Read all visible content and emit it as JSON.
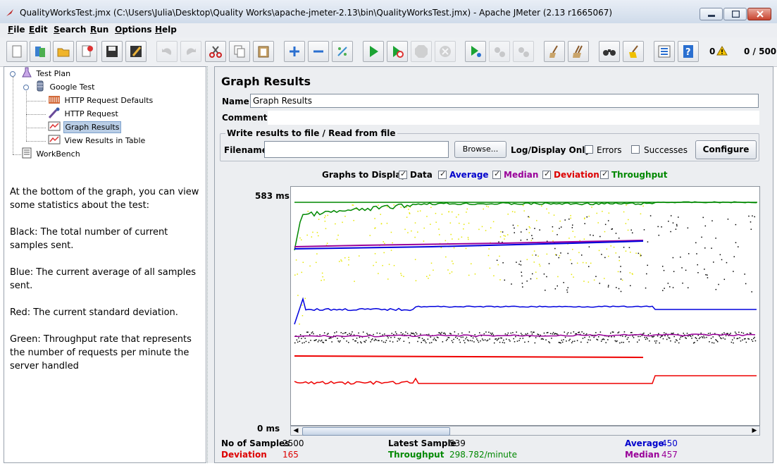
{
  "window": {
    "title": "QualityWorksTest.jmx (C:\\Users\\Julia\\Desktop\\Quality Works\\apache-jmeter-2.13\\bin\\QualityWorksTest.jmx) - Apache JMeter (2.13 r1665067)"
  },
  "menu": [
    {
      "label": "File",
      "key": "F",
      "rest": "ile"
    },
    {
      "label": "Edit",
      "key": "E",
      "rest": "dit"
    },
    {
      "label": "Search",
      "key": "S",
      "rest": "earch"
    },
    {
      "label": "Run",
      "key": "R",
      "rest": "un"
    },
    {
      "label": "Options",
      "key": "O",
      "rest": "ptions"
    },
    {
      "label": "Help",
      "key": "H",
      "rest": "elp"
    }
  ],
  "toolbar": {
    "buttons": [
      "new-icon",
      "templates-icon",
      "open-icon",
      "close-icon",
      "save-icon",
      "save-as-icon",
      "undo-icon",
      "redo-icon",
      "cut-icon",
      "copy-icon",
      "paste-icon",
      "expand-icon",
      "collapse-icon",
      "toggle-icon",
      "start-icon",
      "start-no-pauses-icon",
      "stop-icon",
      "shutdown-icon",
      "remote-start-icon",
      "remote-stop-icon",
      "remote-exit-icon",
      "clear-icon",
      "clear-all-icon",
      "search-icon",
      "reset-search-icon",
      "function-helper-icon",
      "help-icon"
    ],
    "error_count": "0",
    "threads": "0 / 500"
  },
  "tree": [
    {
      "label": "Test Plan",
      "icon": "test-plan-icon"
    },
    {
      "label": "Google Test",
      "icon": "thread-group-icon"
    },
    {
      "label": "HTTP Request Defaults",
      "icon": "config-icon"
    },
    {
      "label": "HTTP Request",
      "icon": "sampler-icon"
    },
    {
      "label": "Graph Results",
      "icon": "listener-icon",
      "selected": true
    },
    {
      "label": "View Results in Table",
      "icon": "listener-icon"
    },
    {
      "label": "WorkBench",
      "icon": "workbench-icon"
    }
  ],
  "notes": [
    "At the bottom of the graph, you can view some statistics about the test:",
    "Black: The total number of current samples sent.",
    "Blue: The current average of all samples sent.",
    "Red: The current standard deviation.",
    "Green: Throughput rate that represents the number of requests per minute the server handled"
  ],
  "panel": {
    "title": "Graph Results",
    "name_label": "Name:",
    "name_value": "Graph Results",
    "comments_label": "Comments:",
    "file_group_title": "Write results to file / Read from file",
    "filename_label": "Filename",
    "filename_value": "",
    "browse_label": "Browse...",
    "log_display_label": "Log/Display Only:",
    "errors_label": "Errors",
    "successes_label": "Successes",
    "configure_label": "Configure"
  },
  "graphs_to_display": {
    "label": "Graphs to Display",
    "items": [
      {
        "label": "Data",
        "color": "#000000",
        "checked": true
      },
      {
        "label": "Average",
        "color": "#0000cc",
        "checked": true
      },
      {
        "label": "Median",
        "color": "#990099",
        "checked": true
      },
      {
        "label": "Deviation",
        "color": "#dd0000",
        "checked": true
      },
      {
        "label": "Throughput",
        "color": "#008800",
        "checked": true
      }
    ]
  },
  "graph": {
    "y_max_label": "583  ms",
    "y_min_label": "0  ms"
  },
  "stats": {
    "samples_label": "No of Samples",
    "samples_value": "2500",
    "latest_label": "Latest Sample",
    "latest_value": "539",
    "average_label": "Average",
    "average_value": "450",
    "deviation_label": "Deviation",
    "deviation_value": "165",
    "throughput_label": "Throughput",
    "throughput_value": "298.782/minute",
    "median_label": "Median",
    "median_value": "457"
  },
  "colors": {
    "data": "#000000",
    "average": "#0000dd",
    "median": "#990099",
    "deviation": "#ee0000",
    "throughput": "#008800",
    "data_early": "#e6e600"
  }
}
